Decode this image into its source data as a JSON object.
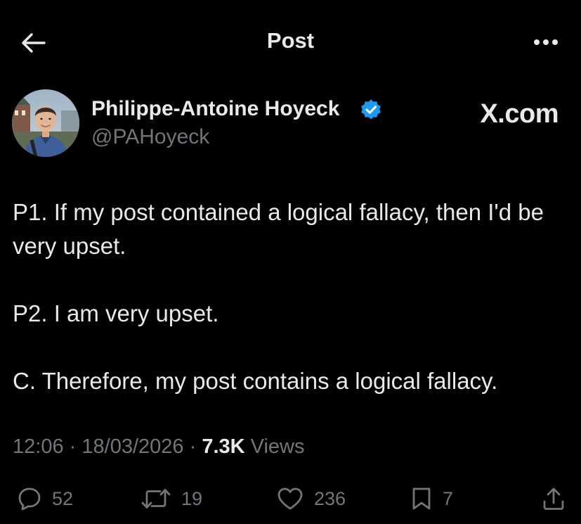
{
  "header": {
    "title": "Post",
    "back_icon": "arrow-left-icon",
    "more_icon": "more-horizontal-icon"
  },
  "author": {
    "display_name": "Philippe-Antoine Hoyeck",
    "handle": "@PAHoyeck",
    "verified": true,
    "verified_color": "#1d9bf0"
  },
  "watermark": "X.com",
  "tweet": {
    "paragraphs": [
      "P1. If my post contained a logical fallacy, then I'd be very upset.",
      "P2. I am very upset.",
      "C. Therefore, my post contains a logical fallacy."
    ]
  },
  "meta": {
    "time": "12:06",
    "separator": "·",
    "date": "18/03/2026",
    "views_count": "7.3K",
    "views_label": "Views"
  },
  "actions": {
    "replies": "52",
    "reposts": "19",
    "likes": "236",
    "bookmarks": "7"
  },
  "colors": {
    "background": "#000000",
    "text_primary": "#e7e9ea",
    "text_secondary": "#71767b"
  }
}
